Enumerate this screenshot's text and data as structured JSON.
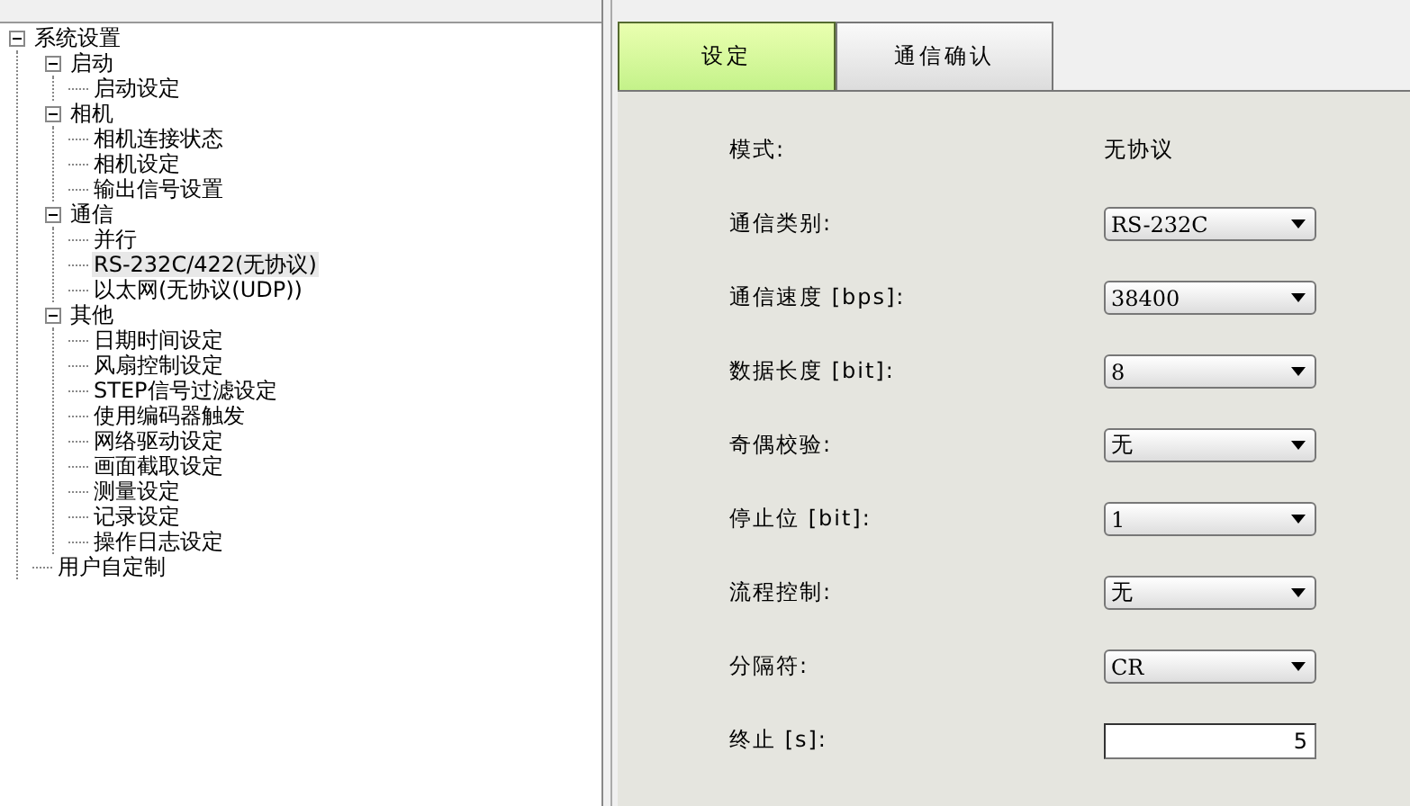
{
  "tree": {
    "label": "系统设置",
    "expanded": true,
    "selected": false,
    "children": [
      {
        "label": "启动",
        "expanded": true,
        "selected": false,
        "children": [
          {
            "label": "启动设定",
            "selected": false
          }
        ]
      },
      {
        "label": "相机",
        "expanded": true,
        "selected": false,
        "children": [
          {
            "label": "相机连接状态",
            "selected": false
          },
          {
            "label": "相机设定",
            "selected": false
          },
          {
            "label": "输出信号设置",
            "selected": false
          }
        ]
      },
      {
        "label": "通信",
        "expanded": true,
        "selected": false,
        "children": [
          {
            "label": "并行",
            "selected": false
          },
          {
            "label": "RS-232C/422(无协议)",
            "selected": true
          },
          {
            "label": "以太网(无协议(UDP))",
            "selected": false
          }
        ]
      },
      {
        "label": "其他",
        "expanded": true,
        "selected": false,
        "children": [
          {
            "label": "日期时间设定",
            "selected": false
          },
          {
            "label": "风扇控制设定",
            "selected": false
          },
          {
            "label": "STEP信号过滤设定",
            "selected": false
          },
          {
            "label": "使用编码器触发",
            "selected": false
          },
          {
            "label": "网络驱动设定",
            "selected": false
          },
          {
            "label": "画面截取设定",
            "selected": false
          },
          {
            "label": "测量设定",
            "selected": false
          },
          {
            "label": "记录设定",
            "selected": false
          },
          {
            "label": "操作日志设定",
            "selected": false
          }
        ]
      },
      {
        "label": "用户自定制",
        "selected": false
      }
    ]
  },
  "tabs": [
    {
      "label": "设定",
      "selected": true
    },
    {
      "label": "通信确认",
      "selected": false
    }
  ],
  "fields": [
    {
      "label": "模式:",
      "kind": "text",
      "value": "无协议"
    },
    {
      "label": "通信类别:",
      "kind": "select",
      "value": "RS-232C"
    },
    {
      "label": "通信速度 [bps]:",
      "kind": "select",
      "value": "38400"
    },
    {
      "label": "数据长度 [bit]:",
      "kind": "select",
      "value": "8"
    },
    {
      "label": "奇偶校验:",
      "kind": "select",
      "value": "无"
    },
    {
      "label": "停止位 [bit]:",
      "kind": "select",
      "value": "1"
    },
    {
      "label": "流程控制:",
      "kind": "select",
      "value": "无"
    },
    {
      "label": "分隔符:",
      "kind": "select",
      "value": "CR"
    },
    {
      "label": "终止 [s]:",
      "kind": "input",
      "value": "5"
    }
  ]
}
